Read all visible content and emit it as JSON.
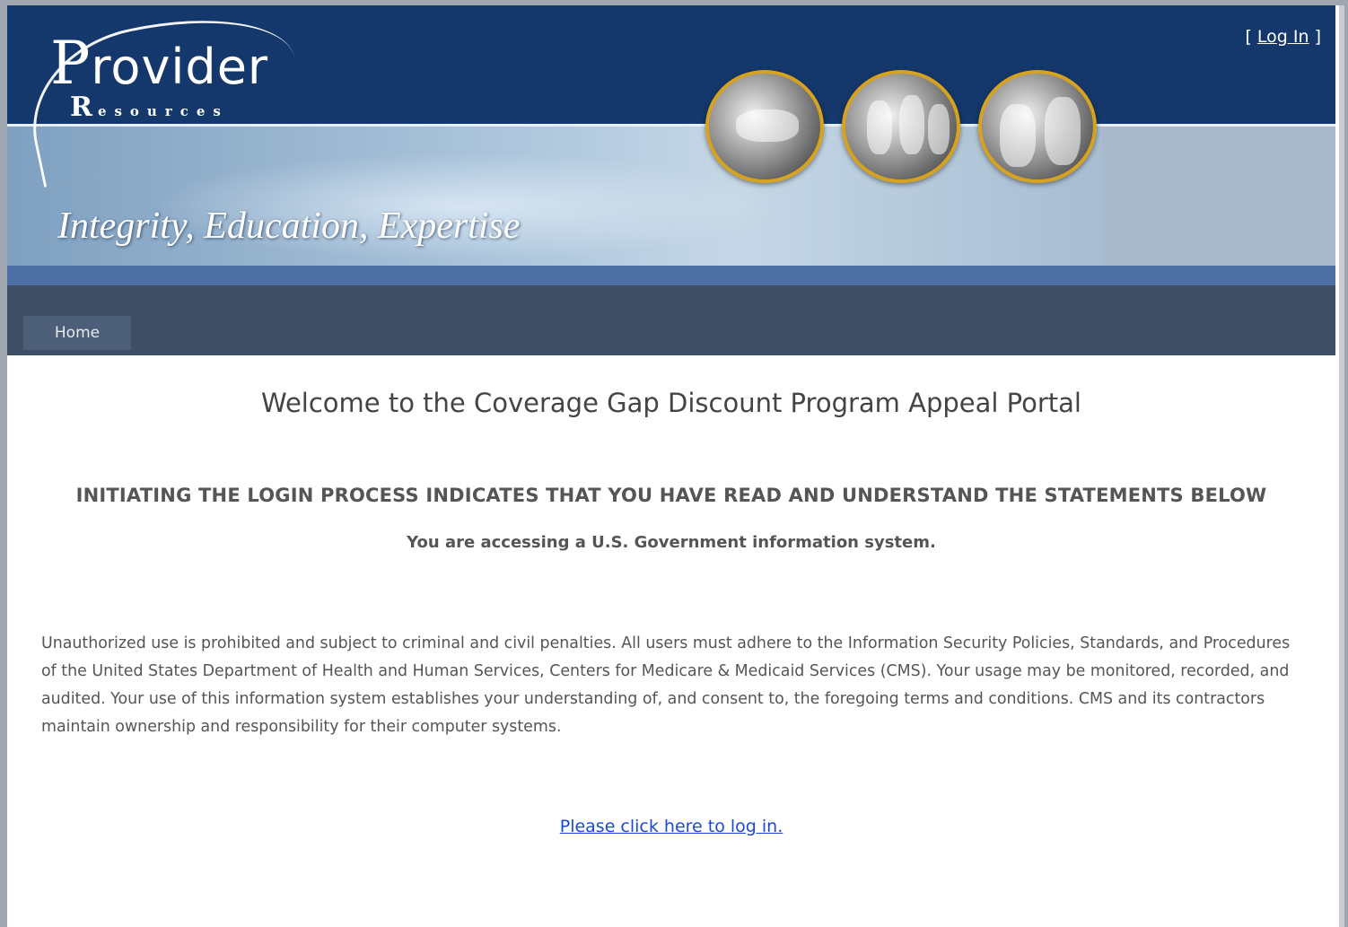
{
  "header": {
    "logo_main": "rovider",
    "logo_initial": "P",
    "logo_sub_initial": "R",
    "logo_sub": "esources",
    "tagline": "Integrity, Education, Expertise",
    "login_open": "[ ",
    "login_label": "Log In",
    "login_close": " ]"
  },
  "nav": {
    "tabs": [
      {
        "label": "Home"
      }
    ]
  },
  "main": {
    "welcome": "Welcome to the Coverage Gap Discount Program Appeal Portal",
    "notice": "INITIATING THE LOGIN PROCESS INDICATES THAT YOU HAVE READ AND UNDERSTAND THE STATEMENTS BELOW",
    "gov_notice": "You are accessing a U.S. Government information system.",
    "body": "Unauthorized use is prohibited and subject to criminal and civil penalties. All users must adhere to the Information Security Policies, Standards, and Procedures of the United States Department of Health and Human Services, Centers for Medicare & Medicaid Services (CMS). Your usage may be monitored, recorded, and audited. Your use of this information system establishes your understanding of, and consent to, the foregoing terms and conditions. CMS and its contractors maintain ownership and responsibility for their computer systems.",
    "login_link": "Please click here to log in."
  },
  "colors": {
    "header_dark": "#14386b",
    "nav_bar": "#3d4e65",
    "accent_gold": "#d7a21e",
    "link_blue": "#1a49d9"
  }
}
